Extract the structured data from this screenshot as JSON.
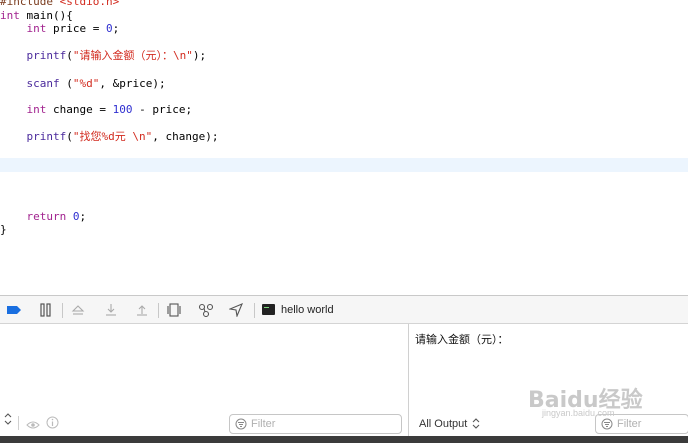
{
  "editor": {
    "lines": [
      {
        "parts": [
          {
            "t": "#include ",
            "c": "pp"
          },
          {
            "t": "<stdio.h>",
            "c": "str"
          }
        ]
      },
      {
        "parts": [
          {
            "t": "int",
            "c": "kw"
          },
          {
            "t": " main(){",
            "c": ""
          }
        ]
      },
      {
        "parts": [
          {
            "t": "    ",
            "c": ""
          },
          {
            "t": "int",
            "c": "kw"
          },
          {
            "t": " price = ",
            "c": ""
          },
          {
            "t": "0",
            "c": "num"
          },
          {
            "t": ";",
            "c": ""
          }
        ]
      },
      {
        "parts": []
      },
      {
        "parts": [
          {
            "t": "    ",
            "c": ""
          },
          {
            "t": "printf",
            "c": "fn"
          },
          {
            "t": "(",
            "c": ""
          },
          {
            "t": "\"请输入金额（元）：\\n\"",
            "c": "str"
          },
          {
            "t": ");",
            "c": ""
          }
        ]
      },
      {
        "parts": []
      },
      {
        "parts": [
          {
            "t": "    ",
            "c": ""
          },
          {
            "t": "scanf",
            "c": "fn"
          },
          {
            "t": " (",
            "c": ""
          },
          {
            "t": "\"%d\"",
            "c": "str"
          },
          {
            "t": ", &price);",
            "c": ""
          }
        ]
      },
      {
        "parts": []
      },
      {
        "parts": [
          {
            "t": "    ",
            "c": ""
          },
          {
            "t": "int",
            "c": "kw"
          },
          {
            "t": " change = ",
            "c": ""
          },
          {
            "t": "100",
            "c": "num"
          },
          {
            "t": " - price;",
            "c": ""
          }
        ]
      },
      {
        "parts": []
      },
      {
        "parts": [
          {
            "t": "    ",
            "c": ""
          },
          {
            "t": "printf",
            "c": "fn"
          },
          {
            "t": "(",
            "c": ""
          },
          {
            "t": "\"找您%d元 \\n\"",
            "c": "str"
          },
          {
            "t": ", change);",
            "c": ""
          }
        ]
      },
      {
        "parts": []
      },
      {
        "parts": []
      },
      {
        "parts": []
      },
      {
        "parts": []
      },
      {
        "parts": [
          {
            "t": "    ",
            "c": ""
          },
          {
            "t": "return",
            "c": "kw"
          },
          {
            "t": " ",
            "c": ""
          },
          {
            "t": "0",
            "c": "num"
          },
          {
            "t": ";",
            "c": ""
          }
        ]
      },
      {
        "parts": [
          {
            "t": "}",
            "c": ""
          }
        ]
      }
    ]
  },
  "debug_toolbar": {
    "target_label": "hello world",
    "icons": [
      "breakpoints-toggle-icon",
      "pause-icon",
      "step-over-icon",
      "step-into-icon",
      "step-out-icon",
      "view-hierarchy-icon",
      "memory-graph-icon",
      "location-icon",
      "terminal-icon"
    ]
  },
  "console": {
    "output_text": "请输入金额（元）：",
    "left_filter_placeholder": "Filter",
    "right_filter_placeholder": "Filter",
    "output_select": "All Output"
  },
  "watermark": {
    "logo_text": "Baidu经验",
    "url_text": "jingyan.baidu.com"
  }
}
